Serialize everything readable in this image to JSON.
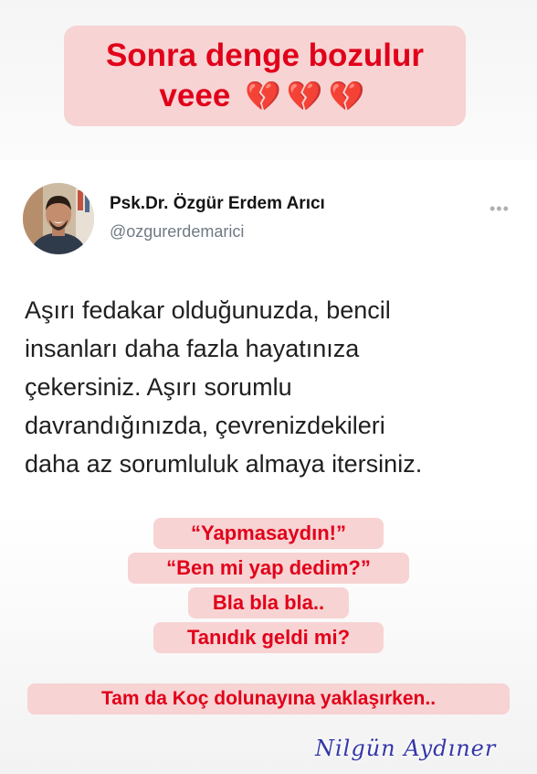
{
  "headline": {
    "line1": "Sonra denge bozulur",
    "line2": "veee",
    "hearts": "💔💔💔",
    "color": "#e1001a",
    "background": "#f7d3d3"
  },
  "tweet": {
    "author_name": "Psk.Dr. Özgür Erdem Arıcı",
    "author_handle": "@ozgurerdemarici",
    "more": "•••",
    "avatar_icon": "profile-photo",
    "text_lines": [
      "Aşırı fedakar olduğunuzda, bencil",
      "insanları daha fazla hayatınıza",
      "çekersiniz. Aşırı sorumlu",
      "davrandığınızda, çevrenizdekileri",
      "daha az sorumluluk almaya itersiniz."
    ]
  },
  "quotes": [
    "“Yapmasaydın!”",
    "“Ben mi yap dedim?”",
    "Bla bla bla..",
    "Tanıdık geldi mi?"
  ],
  "footer_caption": "Tam da Koç dolunayına yaklaşırken..",
  "watermark": "Nilgün Aydıner"
}
